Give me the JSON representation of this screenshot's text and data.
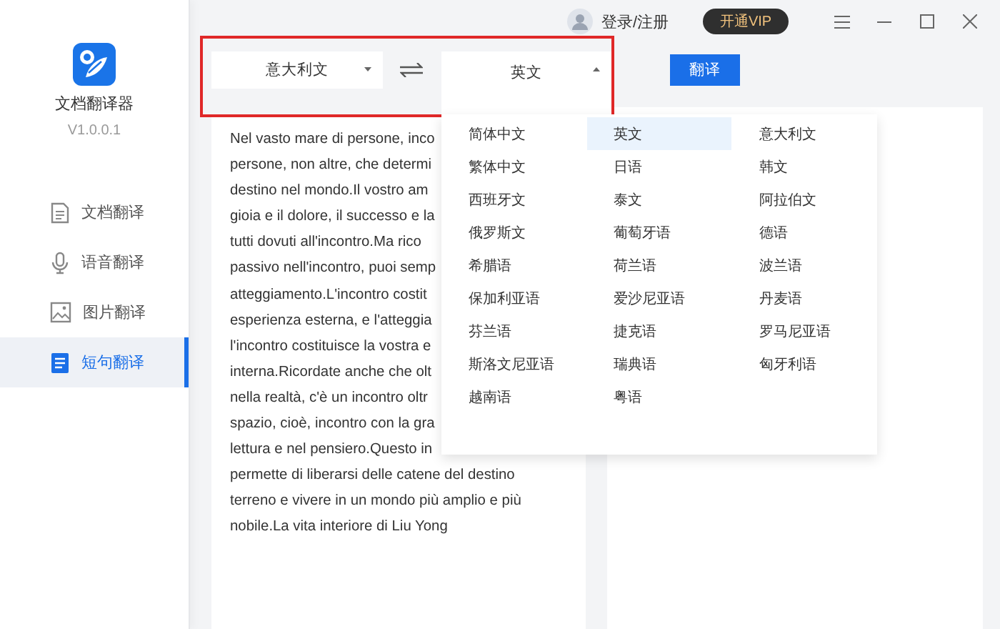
{
  "header": {
    "login": "登录/注册",
    "vip_button": "开通VIP"
  },
  "sidebar": {
    "app_name": "文档翻译器",
    "version": "V1.0.0.1",
    "items": [
      {
        "label": "文档翻译",
        "selected": false
      },
      {
        "label": "语音翻译",
        "selected": false
      },
      {
        "label": "图片翻译",
        "selected": false
      },
      {
        "label": "短句翻译",
        "selected": true
      }
    ]
  },
  "toolbar": {
    "source_language": "意大利文",
    "target_language": "英文",
    "target_expanded": true,
    "translate_button": "翻译"
  },
  "language_menu": {
    "options": [
      {
        "label": "简体中文",
        "selected": false
      },
      {
        "label": "英文",
        "selected": true
      },
      {
        "label": "意大利文",
        "selected": false
      },
      {
        "label": "繁体中文",
        "selected": false
      },
      {
        "label": "日语",
        "selected": false
      },
      {
        "label": "韩文",
        "selected": false
      },
      {
        "label": "西班牙文",
        "selected": false
      },
      {
        "label": "泰文",
        "selected": false
      },
      {
        "label": "阿拉伯文",
        "selected": false
      },
      {
        "label": "俄罗斯文",
        "selected": false
      },
      {
        "label": "葡萄牙语",
        "selected": false
      },
      {
        "label": "德语",
        "selected": false
      },
      {
        "label": "希腊语",
        "selected": false
      },
      {
        "label": "荷兰语",
        "selected": false
      },
      {
        "label": "波兰语",
        "selected": false
      },
      {
        "label": "保加利亚语",
        "selected": false
      },
      {
        "label": "爱沙尼亚语",
        "selected": false
      },
      {
        "label": "丹麦语",
        "selected": false
      },
      {
        "label": "芬兰语",
        "selected": false
      },
      {
        "label": "捷克语",
        "selected": false
      },
      {
        "label": "罗马尼亚语",
        "selected": false
      },
      {
        "label": "斯洛文尼亚语",
        "selected": false
      },
      {
        "label": "瑞典语",
        "selected": false
      },
      {
        "label": "匈牙利语",
        "selected": false
      },
      {
        "label": "越南语",
        "selected": false
      },
      {
        "label": "粤语",
        "selected": false
      }
    ]
  },
  "source_text": {
    "lines": [
      "Nel vasto mare di persone, inco",
      "persone, non altre, che determi",
      "destino nel mondo.Il vostro am",
      "gioia e il dolore, il successo e la",
      "tutti dovuti all'incontro.Ma rico",
      "passivo nell'incontro, puoi semp",
      "atteggiamento.L'incontro costit",
      "esperienza esterna, e l'atteggia",
      "l'incontro costituisce la vostra e",
      "interna.Ricordate anche che olt",
      "nella realtà, c'è un incontro oltr",
      "spazio, cioè, incontro con la gra",
      "lettura e nel pensiero.Questo in",
      "permette di liberarsi delle catene del destino",
      "terreno e vivere in un mondo più amplio e più",
      "nobile.La vita interiore di Liu Yong"
    ]
  }
}
